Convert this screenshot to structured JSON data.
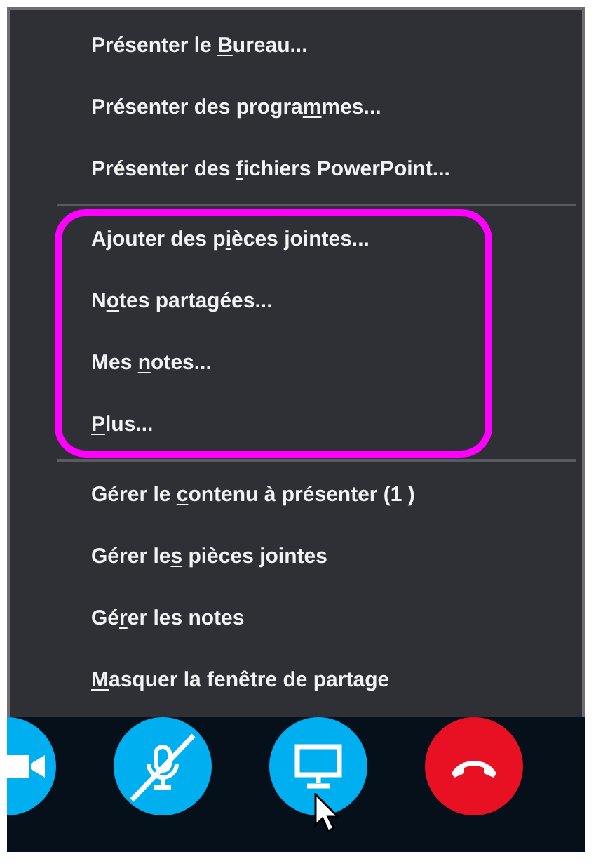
{
  "menu": {
    "groups": [
      {
        "items": [
          {
            "before": "Présenter le ",
            "access_key": "B",
            "after": "ureau..."
          },
          {
            "before": "Présenter des progra",
            "access_key": "m",
            "after": "mes..."
          },
          {
            "before": "Présenter des ",
            "access_key": "f",
            "after": "ichiers PowerPoint..."
          }
        ]
      },
      {
        "highlighted": true,
        "items": [
          {
            "before": "Ajouter des p",
            "access_key": "i",
            "after": "èces jointes..."
          },
          {
            "before": "N",
            "access_key": "o",
            "after": "tes partagées..."
          },
          {
            "before": "Mes ",
            "access_key": "n",
            "after": "otes..."
          },
          {
            "access_key": "P",
            "after": "lus..."
          }
        ]
      },
      {
        "items": [
          {
            "before": "Gérer le ",
            "access_key": "c",
            "after": "ontenu à présenter (1 )"
          },
          {
            "before": "Gérer le",
            "access_key": "s",
            "after": " pièces jointes"
          },
          {
            "before": "Gé",
            "access_key": "r",
            "after": "er les notes"
          },
          {
            "access_key": "M",
            "after": "asquer la fenêtre de partage"
          }
        ]
      }
    ]
  },
  "call_buttons": [
    {
      "kind": "video"
    },
    {
      "kind": "mute"
    },
    {
      "kind": "share"
    },
    {
      "kind": "hangup"
    }
  ]
}
